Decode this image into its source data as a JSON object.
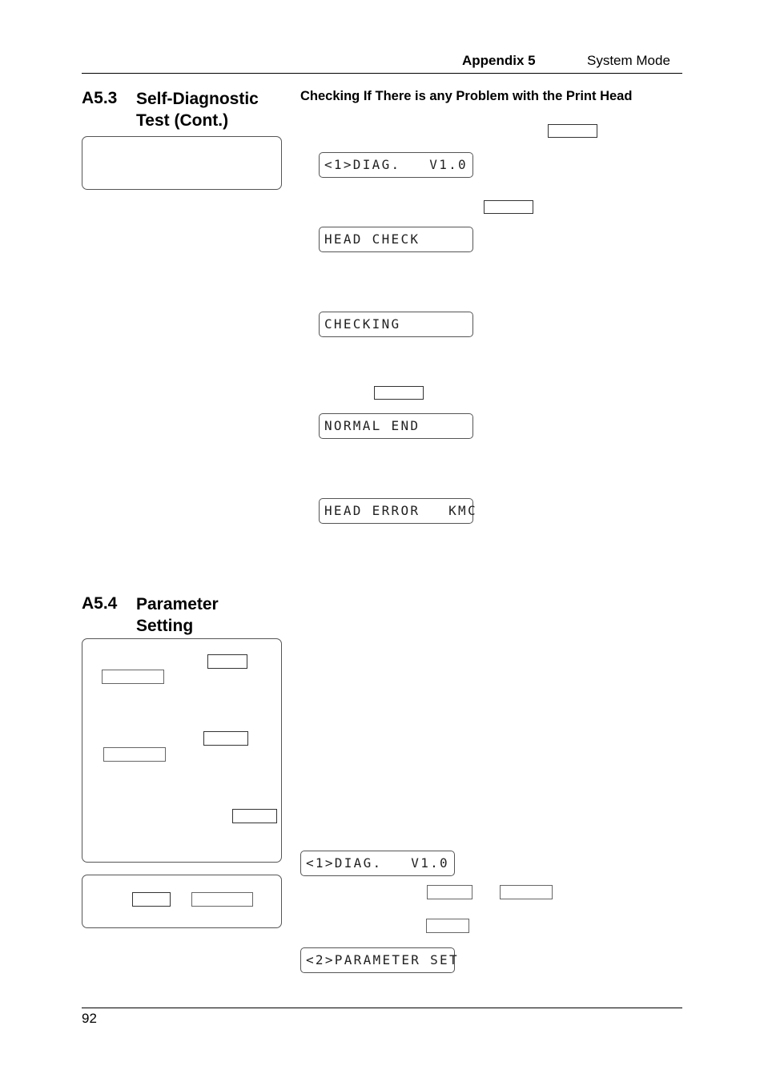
{
  "header": {
    "appendix": "Appendix 5",
    "title": "System Mode"
  },
  "sections": [
    {
      "number": "A5.3",
      "title_line1": "Self-Diagnostic",
      "title_line2": "Test (Cont.)",
      "subheading": "Checking If There is any Problem with the Print Head",
      "displays": [
        "<1>DIAG.   V1.0",
        "HEAD CHECK",
        "CHECKING",
        "NORMAL END",
        "HEAD ERROR   KMC"
      ]
    },
    {
      "number": "A5.4",
      "title_line1": "Parameter",
      "title_line2": "Setting",
      "displays": [
        "<1>DIAG.   V1.0",
        "<2>PARAMETER SET"
      ]
    }
  ],
  "footer": {
    "page_number": "92"
  }
}
